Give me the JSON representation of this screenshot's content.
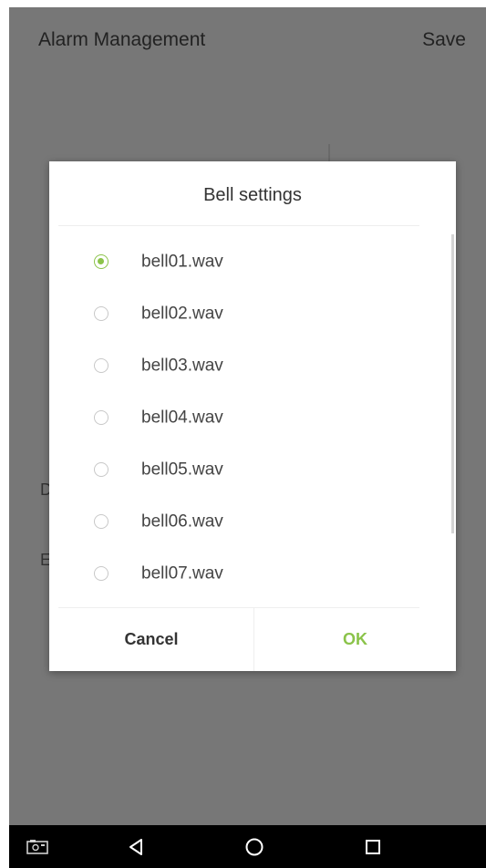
{
  "app": {
    "title": "Alarm Management",
    "save_label": "Save",
    "bg_letters": [
      "D",
      "E"
    ]
  },
  "dialog": {
    "title": "Bell settings",
    "options": [
      {
        "label": "bell01.wav",
        "selected": true
      },
      {
        "label": "bell02.wav",
        "selected": false
      },
      {
        "label": "bell03.wav",
        "selected": false
      },
      {
        "label": "bell04.wav",
        "selected": false
      },
      {
        "label": "bell05.wav",
        "selected": false
      },
      {
        "label": "bell06.wav",
        "selected": false
      },
      {
        "label": "bell07.wav",
        "selected": false
      }
    ],
    "cancel_label": "Cancel",
    "ok_label": "OK"
  },
  "colors": {
    "accent": "#8bc34a",
    "dim_overlay": "#777777",
    "nav_bar": "#000000"
  },
  "nav_bar": {
    "icons": [
      "screenshot-icon",
      "back-icon",
      "home-icon",
      "recents-icon"
    ]
  }
}
